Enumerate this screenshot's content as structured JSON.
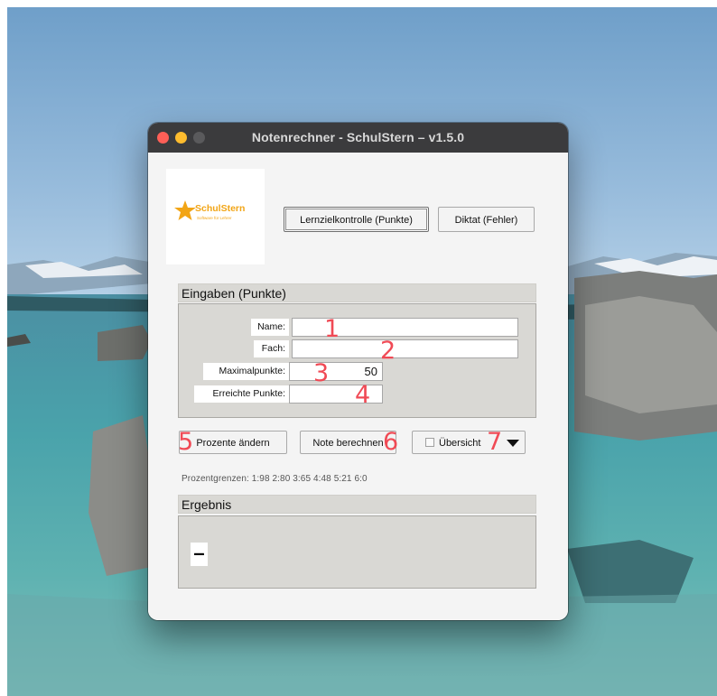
{
  "window": {
    "title": "Notenrechner - SchulStern  –  v1.5.0"
  },
  "logo": {
    "brand": "SchulStern",
    "tagline": "Software für Lehrer"
  },
  "mode_buttons": {
    "lernziel_label": "Lernzielkontrolle (Punkte)",
    "diktat_label": "Diktat (Fehler)"
  },
  "eingaben": {
    "header": "Eingaben (Punkte)",
    "name_label": "Name:",
    "name_value": "",
    "fach_label": "Fach:",
    "fach_value": "",
    "max_label": "Maximalpunkte:",
    "max_value": "50",
    "erreicht_label": "Erreichte Punkte:",
    "erreicht_value": ""
  },
  "actions": {
    "prozente_label": "Prozente ändern",
    "note_label": "Note berechnen",
    "uebersicht_label": "Übersicht"
  },
  "prozentgrenzen": "Prozentgrenzen:  1:98  2:80  3:65  4:48  5:21  6:0",
  "ergebnis": {
    "header": "Ergebnis",
    "value": "–"
  },
  "annotations": {
    "a1": "1",
    "a2": "2",
    "a3": "3",
    "a4": "4",
    "a5": "5",
    "a6": "6",
    "a7": "7",
    "color": "#f04a55"
  },
  "colors": {
    "titlebar": "#3b3b3d",
    "section_bg": "#d9d8d4",
    "logo_orange": "#f2a516"
  },
  "icons": [
    "close-dot-icon",
    "minimize-dot-icon",
    "zoom-dot-icon",
    "star-icon",
    "checkbox-icon",
    "dropdown-arrow-icon"
  ]
}
